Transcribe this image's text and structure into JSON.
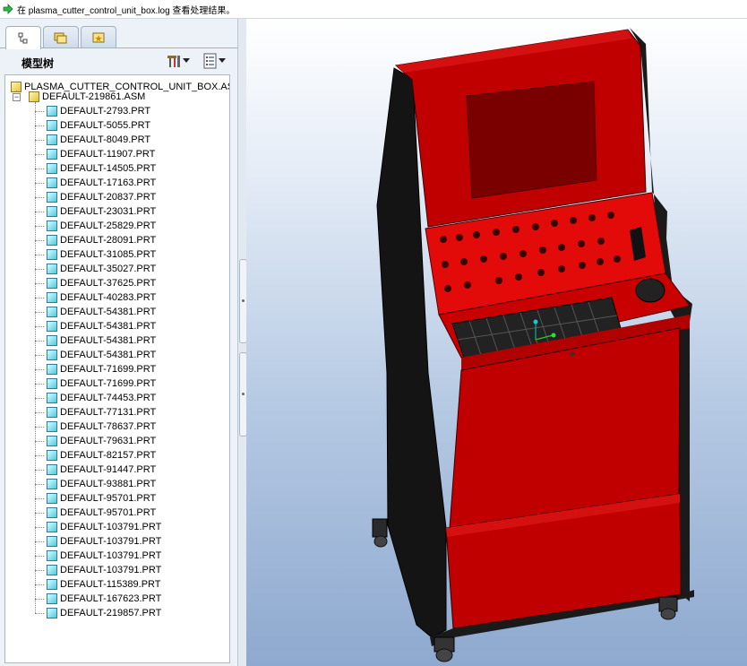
{
  "message_bar": {
    "text": "在 plasma_cutter_control_unit_box.log 查看处理结果。"
  },
  "tabs": [
    {
      "name": "model-tree-tab",
      "icon": "model-tree-icon",
      "active": true
    },
    {
      "name": "folder-browser-tab",
      "icon": "folder-icon",
      "active": false
    },
    {
      "name": "favorites-tab",
      "icon": "favorites-icon",
      "active": false
    }
  ],
  "tree_header": {
    "title": "模型树",
    "tools_icon": "tools-icon",
    "settings_icon": "settings-icon"
  },
  "tree": {
    "root": "PLASMA_CUTTER_CONTROL_UNIT_BOX.ASM",
    "subassembly": "DEFAULT-219861.ASM",
    "parts": [
      "DEFAULT-2793.PRT",
      "DEFAULT-5055.PRT",
      "DEFAULT-8049.PRT",
      "DEFAULT-11907.PRT",
      "DEFAULT-14505.PRT",
      "DEFAULT-17163.PRT",
      "DEFAULT-20837.PRT",
      "DEFAULT-23031.PRT",
      "DEFAULT-25829.PRT",
      "DEFAULT-28091.PRT",
      "DEFAULT-31085.PRT",
      "DEFAULT-35027.PRT",
      "DEFAULT-37625.PRT",
      "DEFAULT-40283.PRT",
      "DEFAULT-54381.PRT",
      "DEFAULT-54381.PRT",
      "DEFAULT-54381.PRT",
      "DEFAULT-54381.PRT",
      "DEFAULT-71699.PRT",
      "DEFAULT-71699.PRT",
      "DEFAULT-74453.PRT",
      "DEFAULT-77131.PRT",
      "DEFAULT-78637.PRT",
      "DEFAULT-79631.PRT",
      "DEFAULT-82157.PRT",
      "DEFAULT-91447.PRT",
      "DEFAULT-93881.PRT",
      "DEFAULT-95701.PRT",
      "DEFAULT-95701.PRT",
      "DEFAULT-103791.PRT",
      "DEFAULT-103791.PRT",
      "DEFAULT-103791.PRT",
      "DEFAULT-103791.PRT",
      "DEFAULT-115389.PRT",
      "DEFAULT-167623.PRT",
      "DEFAULT-219857.PRT"
    ]
  },
  "colors": {
    "cabinet_red": "#c00000",
    "cabinet_black": "#111111",
    "viewport_top": "#ffffff",
    "viewport_bottom": "#8ea9cf"
  }
}
